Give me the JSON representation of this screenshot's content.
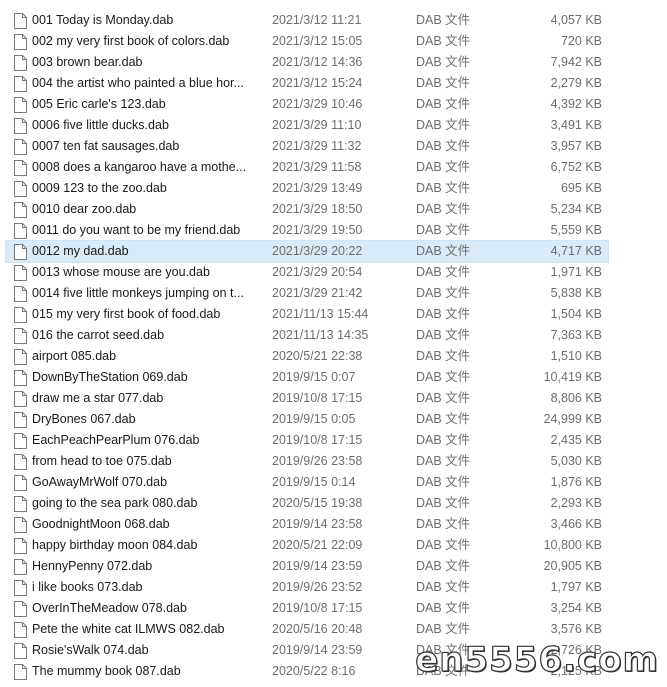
{
  "files": [
    {
      "name": "001 Today is Monday.dab",
      "date": "2021/3/12 11:21",
      "type": "DAB 文件",
      "size": "4,057 KB"
    },
    {
      "name": "002 my very first book of colors.dab",
      "date": "2021/3/12 15:05",
      "type": "DAB 文件",
      "size": "720 KB"
    },
    {
      "name": "003 brown bear.dab",
      "date": "2021/3/12 14:36",
      "type": "DAB 文件",
      "size": "7,942 KB"
    },
    {
      "name": "004 the artist who painted a blue hor...",
      "date": "2021/3/12 15:24",
      "type": "DAB 文件",
      "size": "2,279 KB"
    },
    {
      "name": "005 Eric carle's 123.dab",
      "date": "2021/3/29 10:46",
      "type": "DAB 文件",
      "size": "4,392 KB"
    },
    {
      "name": "0006 five little ducks.dab",
      "date": "2021/3/29 11:10",
      "type": "DAB 文件",
      "size": "3,491 KB"
    },
    {
      "name": "0007 ten fat sausages.dab",
      "date": "2021/3/29 11:32",
      "type": "DAB 文件",
      "size": "3,957 KB"
    },
    {
      "name": "0008 does a kangaroo have a mothe...",
      "date": "2021/3/29 11:58",
      "type": "DAB 文件",
      "size": "6,752 KB"
    },
    {
      "name": "0009 123 to the zoo.dab",
      "date": "2021/3/29 13:49",
      "type": "DAB 文件",
      "size": "695 KB"
    },
    {
      "name": "0010 dear zoo.dab",
      "date": "2021/3/29 18:50",
      "type": "DAB 文件",
      "size": "5,234 KB"
    },
    {
      "name": "0011 do you want to be my friend.dab",
      "date": "2021/3/29 19:50",
      "type": "DAB 文件",
      "size": "5,559 KB"
    },
    {
      "name": "0012 my dad.dab",
      "date": "2021/3/29 20:22",
      "type": "DAB 文件",
      "size": "4,717 KB",
      "selected": true
    },
    {
      "name": "0013 whose mouse are you.dab",
      "date": "2021/3/29 20:54",
      "type": "DAB 文件",
      "size": "1,971 KB"
    },
    {
      "name": "0014 five little monkeys jumping on t...",
      "date": "2021/3/29 21:42",
      "type": "DAB 文件",
      "size": "5,838 KB"
    },
    {
      "name": "015 my very first book of food.dab",
      "date": "2021/11/13 15:44",
      "type": "DAB 文件",
      "size": "1,504 KB"
    },
    {
      "name": "016 the carrot seed.dab",
      "date": "2021/11/13 14:35",
      "type": "DAB 文件",
      "size": "7,363 KB"
    },
    {
      "name": "airport 085.dab",
      "date": "2020/5/21 22:38",
      "type": "DAB 文件",
      "size": "1,510 KB"
    },
    {
      "name": "DownByTheStation 069.dab",
      "date": "2019/9/15 0:07",
      "type": "DAB 文件",
      "size": "10,419 KB"
    },
    {
      "name": "draw me a star 077.dab",
      "date": "2019/10/8 17:15",
      "type": "DAB 文件",
      "size": "8,806 KB"
    },
    {
      "name": "DryBones 067.dab",
      "date": "2019/9/15 0:05",
      "type": "DAB 文件",
      "size": "24,999 KB"
    },
    {
      "name": "EachPeachPearPlum 076.dab",
      "date": "2019/10/8 17:15",
      "type": "DAB 文件",
      "size": "2,435 KB"
    },
    {
      "name": "from head to toe 075.dab",
      "date": "2019/9/26 23:58",
      "type": "DAB 文件",
      "size": "5,030 KB"
    },
    {
      "name": "GoAwayMrWolf 070.dab",
      "date": "2019/9/15 0:14",
      "type": "DAB 文件",
      "size": "1,876 KB"
    },
    {
      "name": "going to the sea park 080.dab",
      "date": "2020/5/15 19:38",
      "type": "DAB 文件",
      "size": "2,293 KB"
    },
    {
      "name": "GoodnightMoon 068.dab",
      "date": "2019/9/14 23:58",
      "type": "DAB 文件",
      "size": "3,466 KB"
    },
    {
      "name": "happy birthday moon 084.dab",
      "date": "2020/5/21 22:09",
      "type": "DAB 文件",
      "size": "10,800 KB"
    },
    {
      "name": "HennyPenny 072.dab",
      "date": "2019/9/14 23:59",
      "type": "DAB 文件",
      "size": "20,905 KB"
    },
    {
      "name": "i like books 073.dab",
      "date": "2019/9/26 23:52",
      "type": "DAB 文件",
      "size": "1,797 KB"
    },
    {
      "name": "OverInTheMeadow 078.dab",
      "date": "2019/10/8 17:15",
      "type": "DAB 文件",
      "size": "3,254 KB"
    },
    {
      "name": "Pete the white cat ILMWS 082.dab",
      "date": "2020/5/16 20:48",
      "type": "DAB 文件",
      "size": "3,576 KB"
    },
    {
      "name": "Rosie'sWalk 074.dab",
      "date": "2019/9/14 23:59",
      "type": "DAB 文件",
      "size": "2,726 KB"
    },
    {
      "name": "The mummy book 087.dab",
      "date": "2020/5/22 8:16",
      "type": "DAB 文件",
      "size": "2,125 KB"
    }
  ],
  "watermark": {
    "text": "en5556.com"
  },
  "colors": {
    "selected_row": "#d9ebf9",
    "secondary_text": "#6d6d6d",
    "primary_text": "#1a1a1a"
  },
  "icons": {
    "file": "file-icon"
  }
}
